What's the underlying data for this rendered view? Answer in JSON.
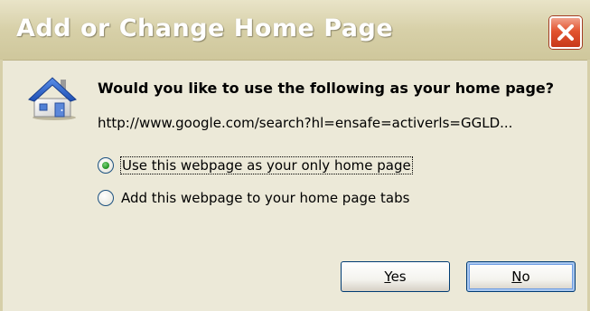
{
  "dialog": {
    "title": "Add or Change Home Page",
    "question": "Would you like to use the following as your home page?",
    "url": "http://www.google.com/search?hl=ensafe=activerls=GGLD..."
  },
  "options": [
    {
      "label": "Use this webpage as your only home page",
      "selected": true
    },
    {
      "label": "Add this webpage to your home page tabs",
      "selected": false
    }
  ],
  "buttons": {
    "yes": {
      "label": "Yes",
      "accesskey": "Y"
    },
    "no": {
      "label": "No",
      "accesskey": "N"
    }
  },
  "icons": {
    "dialog_icon": "house-icon",
    "close": "close-icon"
  },
  "colors": {
    "close_button": "#e2542f",
    "dialog_background": "#ece9d8",
    "radio_selected": "#2b9a2b"
  }
}
